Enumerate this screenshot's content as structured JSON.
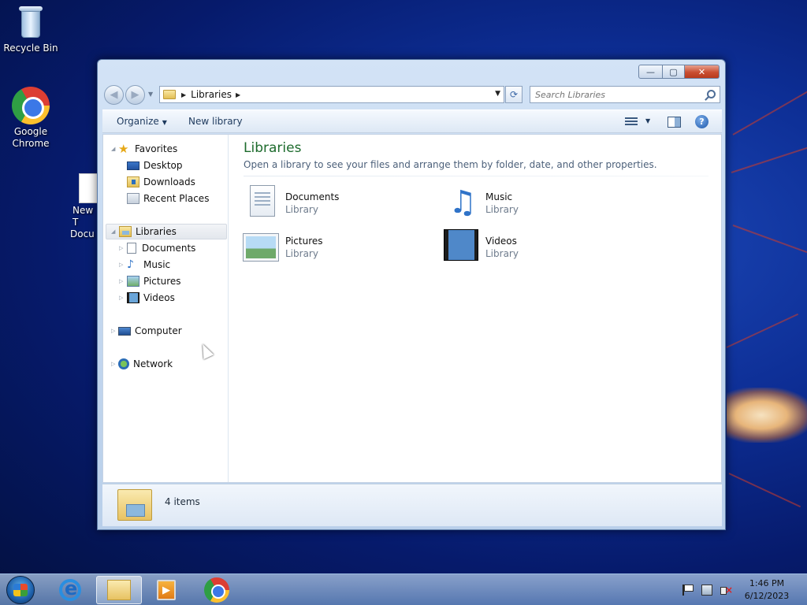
{
  "desktop": {
    "icons": [
      {
        "label": "Recycle Bin",
        "icon": "recycle-bin-icon"
      },
      {
        "label": "Google Chrome",
        "icon": "chrome-icon"
      },
      {
        "label": "New T... Docu...",
        "label_line1": "New T",
        "label_line2": "Docu",
        "icon": "text-document-icon"
      }
    ]
  },
  "window": {
    "caption_buttons": {
      "minimize": "—",
      "maximize": "▢",
      "close": "✕"
    },
    "address": {
      "segment": "Libraries"
    },
    "search": {
      "placeholder": "Search Libraries"
    },
    "toolbar": {
      "organize": "Organize",
      "new_library": "New library",
      "help": "?"
    },
    "nav_pane": {
      "favorites": {
        "label": "Favorites",
        "items": [
          "Desktop",
          "Downloads",
          "Recent Places"
        ]
      },
      "libraries": {
        "label": "Libraries",
        "items": [
          "Documents",
          "Music",
          "Pictures",
          "Videos"
        ]
      },
      "computer": "Computer",
      "network": "Network"
    },
    "main": {
      "title": "Libraries",
      "subtitle": "Open a library to see your files and arrange them by folder, date, and other properties.",
      "libraries": [
        {
          "name": "Documents",
          "type": "Library",
          "icon": "documents-library-icon"
        },
        {
          "name": "Music",
          "type": "Library",
          "icon": "music-library-icon"
        },
        {
          "name": "Pictures",
          "type": "Library",
          "icon": "pictures-library-icon"
        },
        {
          "name": "Videos",
          "type": "Library",
          "icon": "videos-library-icon"
        }
      ]
    },
    "details": {
      "item_count": "4 items"
    }
  },
  "taskbar": {
    "apps": [
      "Internet Explorer",
      "Windows Explorer",
      "Windows Media Player",
      "Google Chrome"
    ],
    "clock": {
      "time": "1:46 PM",
      "date": "6/12/2023"
    }
  },
  "colors": {
    "library_title": "#1d6b2d",
    "selection": "#e3e7ed"
  }
}
